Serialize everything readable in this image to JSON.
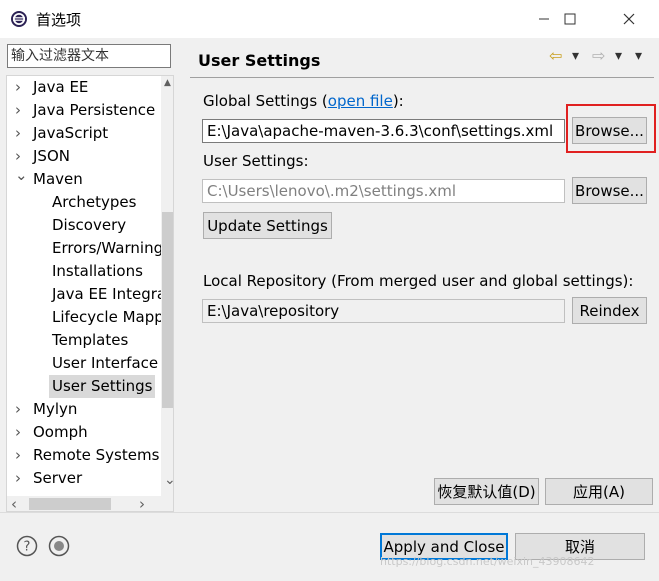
{
  "window": {
    "title": "首选项",
    "minimize_label": "–",
    "maximize_label": "☐",
    "close_label": "✕"
  },
  "filter": {
    "placeholder": "输入过滤器文本"
  },
  "tree": {
    "items": [
      {
        "label": "Java EE",
        "arrow": "›"
      },
      {
        "label": "Java Persistence",
        "arrow": "›"
      },
      {
        "label": "JavaScript",
        "arrow": "›"
      },
      {
        "label": "JSON",
        "arrow": "›"
      },
      {
        "label": "Maven",
        "arrow": "⌄"
      },
      {
        "label": "Archetypes"
      },
      {
        "label": "Discovery"
      },
      {
        "label": "Errors/Warnings"
      },
      {
        "label": "Installations"
      },
      {
        "label": "Java EE Integration"
      },
      {
        "label": "Lifecycle Mappings"
      },
      {
        "label": "Templates"
      },
      {
        "label": "User Interface"
      },
      {
        "label": "User Settings"
      },
      {
        "label": "Mylyn",
        "arrow": "›"
      },
      {
        "label": "Oomph",
        "arrow": "›"
      },
      {
        "label": "Remote Systems",
        "arrow": "›"
      },
      {
        "label": "Server",
        "arrow": "›"
      }
    ],
    "scroll_up": "▲",
    "scroll_down": "⌄",
    "scroll_left": "‹",
    "scroll_right": "›"
  },
  "page": {
    "title": "User Settings",
    "nav_back": "⇦",
    "nav_forward": "⇨",
    "nav_dropdown": "▾",
    "menu": "▾",
    "global_label_pre": "Global Settings (",
    "global_link": "open file",
    "global_label_post": "):",
    "global_path": "E:\\Java\\apache-maven-3.6.3\\conf\\settings.xml",
    "browse_label": "Browse...",
    "user_label": "User Settings:",
    "user_path": "C:\\Users\\lenovo\\.m2\\settings.xml",
    "update_label": "Update Settings",
    "local_repo_label": "Local Repository (From merged user and global settings):",
    "local_repo_path": "E:\\Java\\repository",
    "reindex_label": "Reindex",
    "restore_defaults_label": "恢复默认值(D)",
    "apply_label": "应用(A)"
  },
  "footer": {
    "help_icon": "?",
    "apply_close_label": "Apply and Close",
    "cancel_label": "取消",
    "watermark": "https://blog.csdn.net/weixin_43908642"
  },
  "colors": {
    "highlight_border": "#e02020",
    "link": "#0066cc",
    "selection": "#d9d9d9",
    "default_button_border": "#0078d7"
  }
}
